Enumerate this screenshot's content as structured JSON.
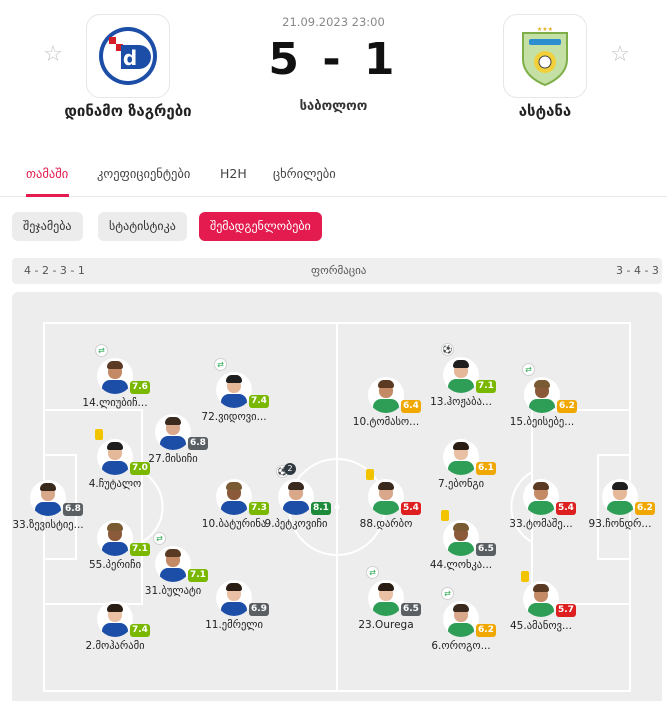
{
  "match": {
    "date": "21.09.2023 23:00",
    "score": "5 - 1",
    "status": "საბოლოო",
    "home": {
      "name": "დინამო ზაგრები",
      "color": "#1c4ea8"
    },
    "away": {
      "name": "ასტანა",
      "color": "#2e9e57"
    }
  },
  "tabs": [
    {
      "label": "თამაში",
      "active": true
    },
    {
      "label": "კოეფიციენტები",
      "active": false
    },
    {
      "label": "H2H",
      "active": false
    },
    {
      "label": "ცხრილები",
      "active": false
    }
  ],
  "subtabs": [
    {
      "label": "შეჯამება",
      "active": false
    },
    {
      "label": "სტატისტიკა",
      "active": false
    },
    {
      "label": "შემადგენლობები",
      "active": true
    }
  ],
  "formation": {
    "home": "4 - 2 - 3 - 1",
    "label": "ფორმაცია",
    "away": "3 - 4 - 3"
  },
  "rating_colors": {
    "green": "#7ab800",
    "orange": "#f0a800",
    "red": "#dd1f1f",
    "gray": "#5a5f63",
    "dark_green": "#1e8b3a"
  },
  "players": [
    {
      "name": "33.ზევისტიე...",
      "rating": "6.8",
      "color": "gray",
      "side": "home",
      "event": ""
    },
    {
      "name": "14.ლიუბიჩ...",
      "rating": "7.6",
      "color": "green",
      "side": "home",
      "event": "sub"
    },
    {
      "name": "4.ჩუტალო",
      "rating": "7.0",
      "color": "green",
      "side": "home",
      "event": "yellow"
    },
    {
      "name": "55.პერიჩი",
      "rating": "7.1",
      "color": "green",
      "side": "home",
      "event": ""
    },
    {
      "name": "2.მოჰარამი",
      "rating": "7.4",
      "color": "green",
      "side": "home",
      "event": ""
    },
    {
      "name": "27.მისიჩი",
      "rating": "6.8",
      "color": "gray",
      "side": "home",
      "event": ""
    },
    {
      "name": "31.ბულატი",
      "rating": "7.1",
      "color": "green",
      "side": "home",
      "event": "sub"
    },
    {
      "name": "72.ვიდოვი...",
      "rating": "7.4",
      "color": "green",
      "side": "home",
      "event": "sub"
    },
    {
      "name": "10.ბატურინა",
      "rating": "7.3",
      "color": "green",
      "side": "home",
      "event": ""
    },
    {
      "name": "11.ემრელი",
      "rating": "6.9",
      "color": "gray",
      "side": "home",
      "event": ""
    },
    {
      "name": "9.პეტკოვიჩი",
      "rating": "8.1",
      "color": "dark_green",
      "side": "home",
      "event": "ball",
      "goals": "2"
    },
    {
      "name": "10.ტომასო...",
      "rating": "6.4",
      "color": "orange",
      "side": "away",
      "event": ""
    },
    {
      "name": "13.ჰოჟაბა...",
      "rating": "7.1",
      "color": "green",
      "side": "away",
      "event": "ball"
    },
    {
      "name": "15.ბეისებე...",
      "rating": "6.2",
      "color": "orange",
      "side": "away",
      "event": "sub"
    },
    {
      "name": "7.ებონგი",
      "rating": "6.1",
      "color": "orange",
      "side": "away",
      "event": ""
    },
    {
      "name": "88.დარბო",
      "rating": "5.4",
      "color": "red",
      "side": "away",
      "event": "yellow"
    },
    {
      "name": "33.ტომაშე...",
      "rating": "5.4",
      "color": "red",
      "side": "away",
      "event": ""
    },
    {
      "name": "93.ჩონდრ...",
      "rating": "6.2",
      "color": "orange",
      "side": "away",
      "event": ""
    },
    {
      "name": "44.ლოხკა...",
      "rating": "6.5",
      "color": "gray",
      "side": "away",
      "event": "yellow"
    },
    {
      "name": "23.Ourega",
      "rating": "6.5",
      "color": "gray",
      "side": "away",
      "event": "sub"
    },
    {
      "name": "6.ოროგო...",
      "rating": "6.2",
      "color": "orange",
      "side": "away",
      "event": "sub"
    },
    {
      "name": "45.ამანოვ...",
      "rating": "5.7",
      "color": "red",
      "side": "away",
      "event": "yellow"
    }
  ]
}
